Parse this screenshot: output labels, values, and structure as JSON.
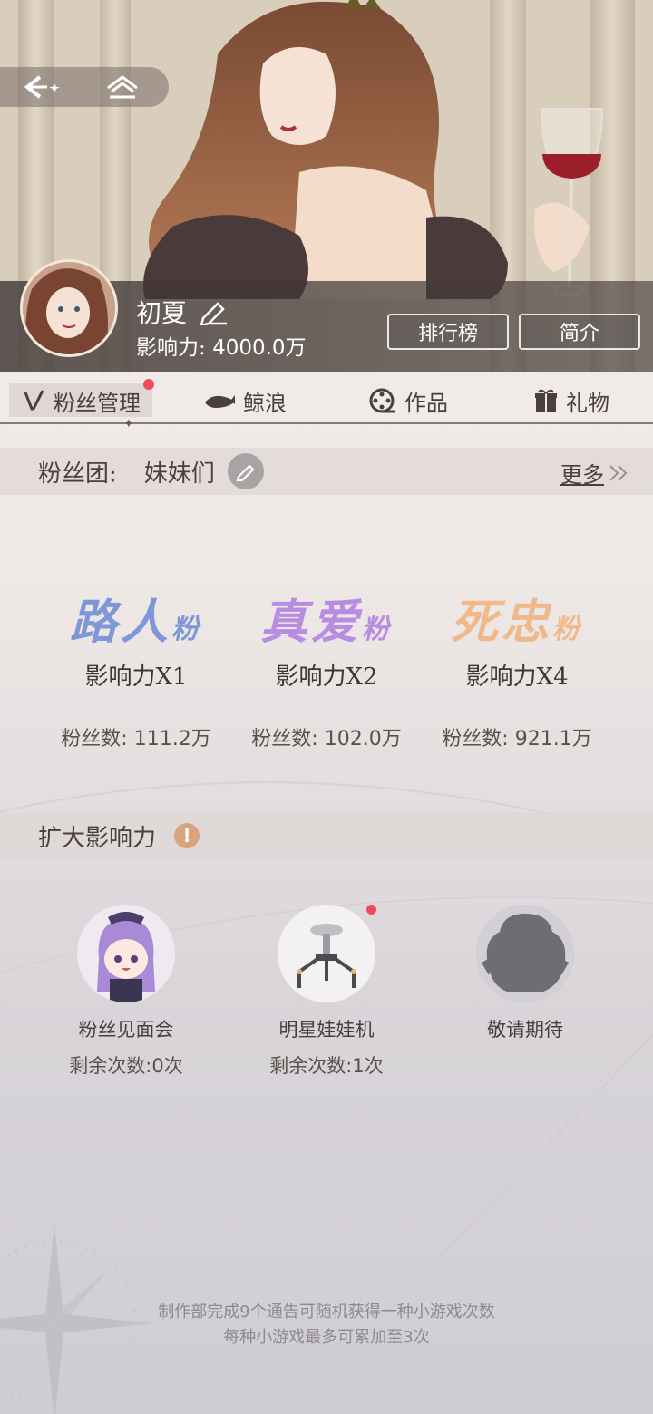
{
  "header": {
    "nav": {
      "back_icon": "back-arrow-sparkle-icon",
      "home_icon": "home-icon"
    },
    "profile": {
      "name": "初夏",
      "influence_label": "影响力:",
      "influence_value": "4000.0万"
    },
    "buttons": {
      "ranking": "排行榜",
      "intro": "简介"
    }
  },
  "tabs": [
    {
      "label": "粉丝管理",
      "icon": "v-icon",
      "active": true,
      "badge": true
    },
    {
      "label": "鲸浪",
      "icon": "whale-icon",
      "active": false
    },
    {
      "label": "作品",
      "icon": "film-reel-icon",
      "active": false
    },
    {
      "label": "礼物",
      "icon": "gift-icon",
      "active": false
    }
  ],
  "fan_club": {
    "label": "粉丝团:",
    "name": "妹妹们",
    "more": "更多"
  },
  "tiers": [
    {
      "title": "路人",
      "suffix": "粉",
      "multiplier": "影响力X1",
      "fans_label": "粉丝数:",
      "fans_value": "111.2万",
      "color": "#7f97d6"
    },
    {
      "title": "真爱",
      "suffix": "粉",
      "multiplier": "影响力X2",
      "fans_label": "粉丝数:",
      "fans_value": "102.0万",
      "color": "#b88ce0"
    },
    {
      "title": "死忠",
      "suffix": "粉",
      "multiplier": "影响力X4",
      "fans_label": "粉丝数:",
      "fans_value": "921.1万",
      "color": "#f0b98c"
    }
  ],
  "expand": {
    "title": "扩大影响力",
    "games": [
      {
        "name": "粉丝见面会",
        "count": "剩余次数:0次",
        "icon": "chibi-girl-icon"
      },
      {
        "name": "明星娃娃机",
        "count": "剩余次数:1次",
        "icon": "claw-machine-icon",
        "badge": true
      },
      {
        "name": "敬请期待",
        "count": "",
        "icon": "locked-silhouette-icon"
      }
    ]
  },
  "footer": {
    "line1": "制作部完成9个通告可随机获得一种小游戏次数",
    "line2": "每种小游戏最多可累加至3次"
  }
}
